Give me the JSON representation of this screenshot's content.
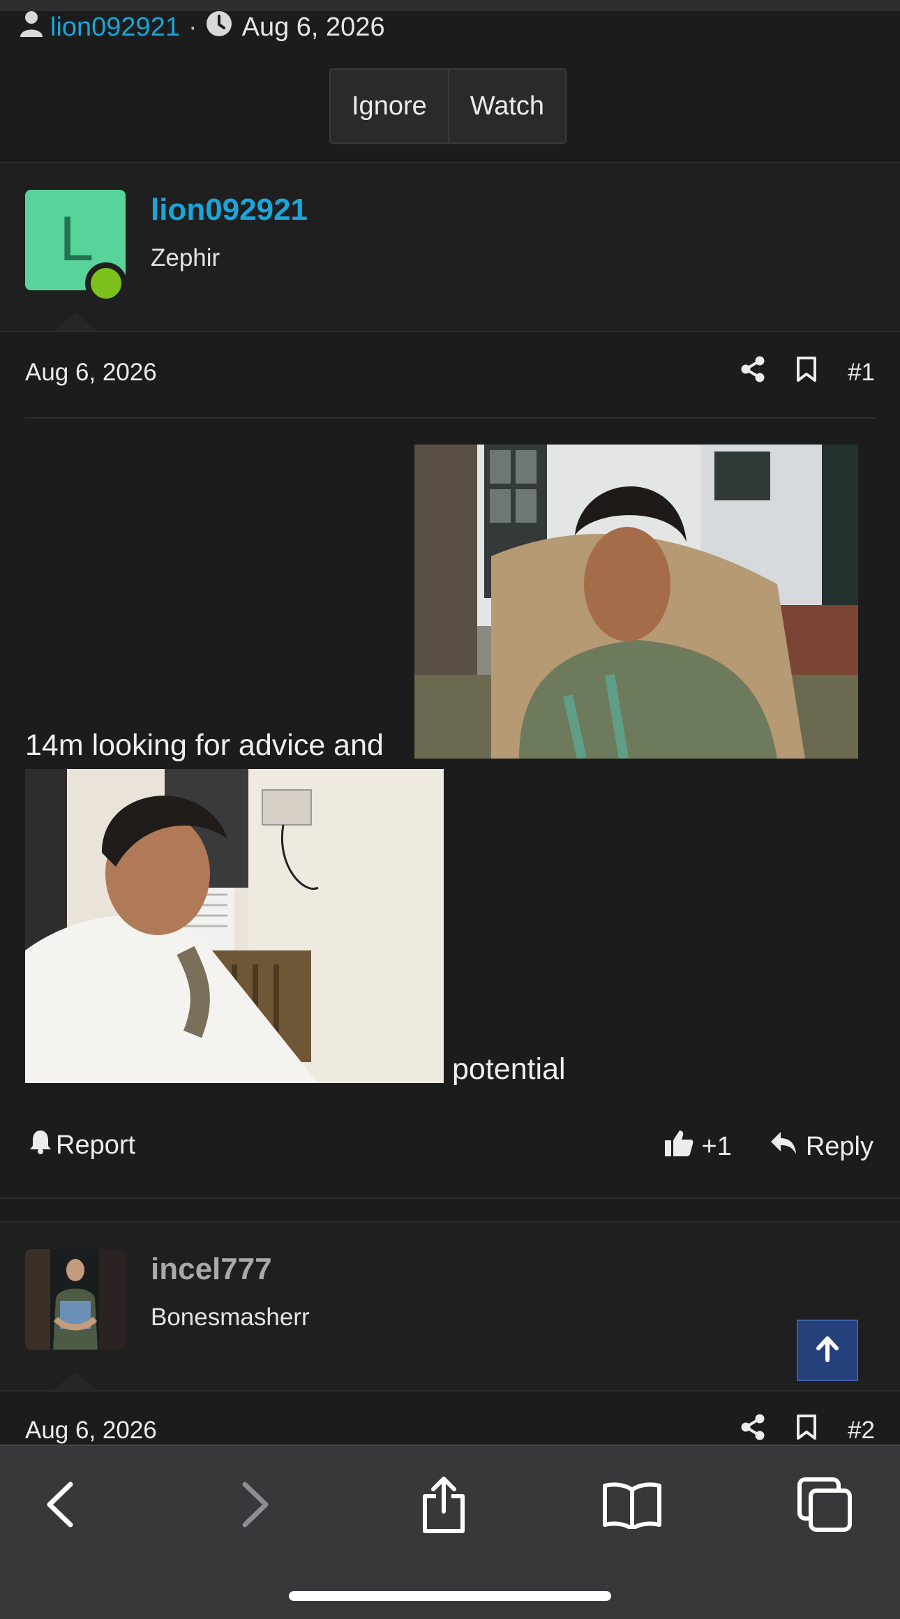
{
  "thread_meta": {
    "author": "lion092921",
    "separator": "·",
    "date": "Aug 6, 2026"
  },
  "thread_buttons": {
    "ignore": "Ignore",
    "watch": "Watch"
  },
  "posts": [
    {
      "avatar_letter": "L",
      "username": "lion092921",
      "user_title": "Zephir",
      "date": "Aug 6, 2026",
      "post_number": "#1",
      "body_text_before": "14m looking for advice and",
      "body_text_after": "potential",
      "report_label": "Report",
      "like_count": "+1",
      "reply_label": "Reply"
    },
    {
      "username": "incel777",
      "user_title": "Bonesmasherr",
      "date": "Aug 6, 2026",
      "post_number": "#2"
    }
  ],
  "colors": {
    "background": "#1c1c1d",
    "link": "#19a6d9",
    "avatar_bg": "#58d39a",
    "online_dot": "#7cc11b",
    "scroll_top_bg": "#24407a"
  },
  "icons": {
    "user": "user-icon",
    "clock": "clock-icon",
    "share": "share-icon",
    "bookmark": "bookmark-icon",
    "report": "bell-icon",
    "like": "thumbs-up-icon",
    "reply": "reply-icon",
    "scroll_top": "arrow-up-icon",
    "browser_back": "chevron-left-icon",
    "browser_forward": "chevron-right-icon",
    "browser_share": "share-box-icon",
    "browser_bookmarks": "book-icon",
    "browser_tabs": "tabs-icon"
  }
}
